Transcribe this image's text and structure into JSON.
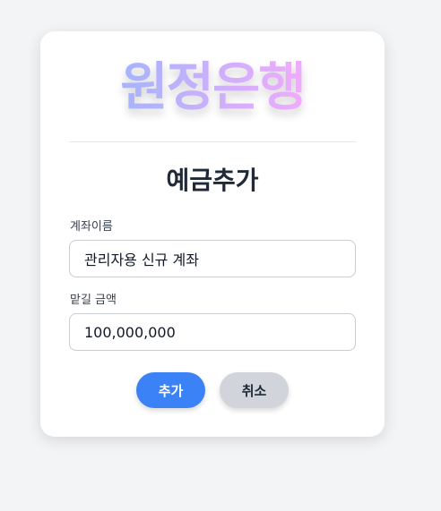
{
  "brand": {
    "name": "원정은행",
    "gradient_start": "#a5b4fc",
    "gradient_end": "#f0abfc"
  },
  "form": {
    "title": "예금추가",
    "account_name_label": "계좌이름",
    "account_name_value": "관리자용 신규 계좌",
    "deposit_label": "맡길 금액",
    "deposit_value": "100,000,000"
  },
  "buttons": {
    "add_label": "추가",
    "cancel_label": "취소",
    "add_color": "#3b82f6",
    "cancel_color": "#d1d5db"
  }
}
